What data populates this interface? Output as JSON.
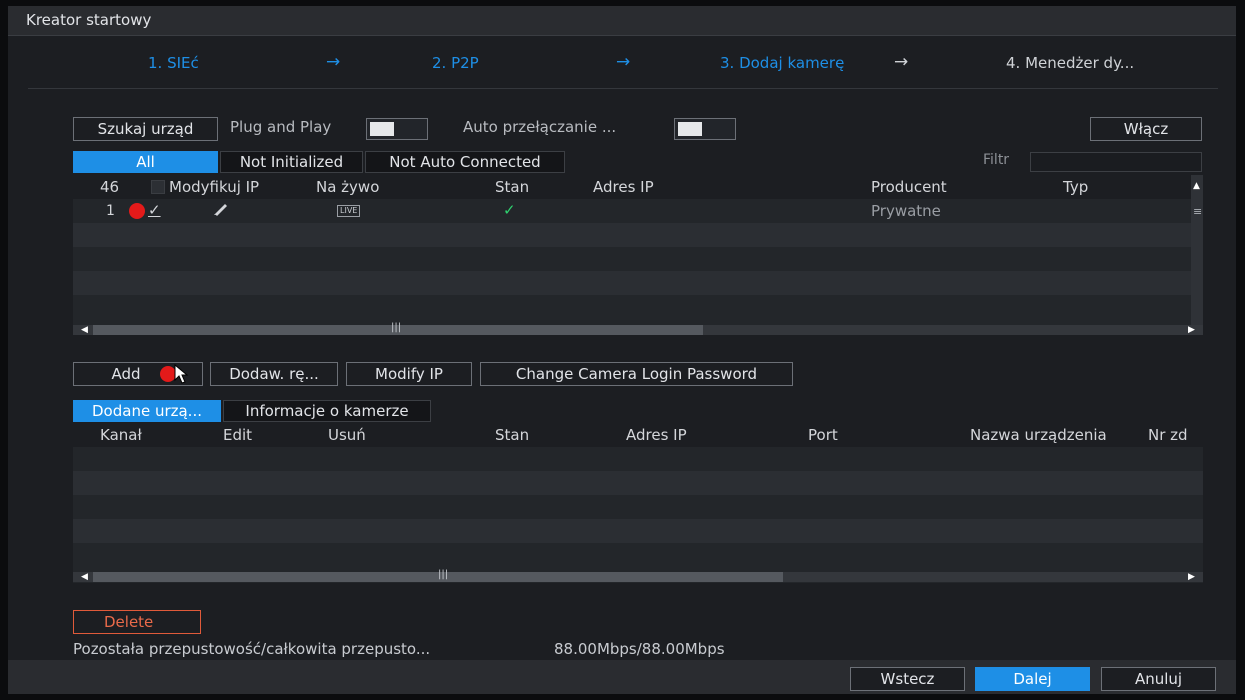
{
  "window": {
    "title": "Kreator startowy"
  },
  "steps": [
    {
      "label": "1.  SIEć",
      "state": "active"
    },
    {
      "label": "2.  P2P",
      "state": "active"
    },
    {
      "label": "3.  Dodaj kamerę",
      "state": "active"
    },
    {
      "label": "4.  Menedżer dy...",
      "state": "inactive"
    }
  ],
  "step_arrow": "→",
  "toolbar": {
    "search_button": "Szukaj urząd",
    "plug_and_play_label": "Plug and Play",
    "auto_switch_label": "Auto przełączanie ...",
    "enable_button": "Włącz"
  },
  "search_tabs": [
    "All",
    "Not Initialized",
    "Not Auto Connected"
  ],
  "filter_label": "Filtr",
  "search_table": {
    "count": "46",
    "columns": [
      "Modyfikuj IP",
      "Na żywo",
      "Stan",
      "Adres IP",
      "Producent",
      "Typ"
    ],
    "rows": [
      {
        "index": "1",
        "live": "LIVE",
        "status_icon": "check-icon",
        "ip": "",
        "manufacturer": "Prywatne",
        "type": ""
      }
    ]
  },
  "action_buttons": {
    "add": "Add",
    "manual_add": "Dodaw. rę...",
    "modify_ip": "Modify IP",
    "change_password": "Change Camera Login Password"
  },
  "added_tabs": [
    "Dodane urzą...",
    "Informacje o kamerze"
  ],
  "added_table": {
    "columns": [
      "Kanał",
      "Edit",
      "Usuń",
      "Stan",
      "Adres IP",
      "Port",
      "Nazwa urządzenia",
      "Nr zd"
    ]
  },
  "delete_button": "Delete",
  "bandwidth": {
    "label": "Pozostała przepustowość/całkowita przepusto...",
    "value": "88.00Mbps/88.00Mbps"
  },
  "footer": {
    "back": "Wstecz",
    "next": "Dalej",
    "cancel": "Anuluj"
  },
  "colors": {
    "accent": "#1e8fe6",
    "danger": "#e05a3a",
    "marker": "#e31a1a",
    "status_ok": "#2ed06e"
  }
}
